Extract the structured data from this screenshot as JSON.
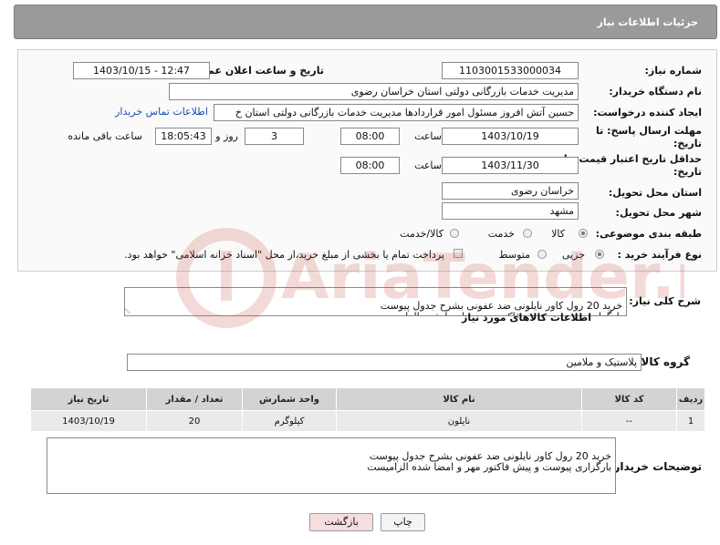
{
  "header": {
    "title": "جزئیات اطلاعات نیاز"
  },
  "form": {
    "need_number_label": "شماره نیاز:",
    "need_number": "1103001533000034",
    "announce_label": "تاریخ و ساعت اعلان عمومی:",
    "announce_value": "1403/10/15 - 12:47",
    "buyer_org_label": "نام دستگاه خریدار:",
    "buyer_org": "مدیریت خدمات بازرگانی دولتی استان خراسان رضوی",
    "creator_label": "ایجاد کننده درخواست:",
    "creator": "حسین آتش افروز مسئول امور قراردادها مدیریت خدمات بازرگانی دولتی استان خ",
    "contact_link": "اطلاعات تماس خریدار",
    "reply_deadline_label_1": "مهلت ارسال پاسخ: تا",
    "reply_deadline_label_2": "تاریخ:",
    "reply_date": "1403/10/19",
    "time_label": "ساعت",
    "reply_time": "08:00",
    "days_value": "3",
    "days_label": "روز و",
    "remaining_time": "18:05:43",
    "remaining_label": "ساعت باقی مانده",
    "price_validity_label_1": "حداقل تاریخ اعتبار قیمت: تا",
    "price_validity_label_2": "تاریخ:",
    "price_date": "1403/11/30",
    "price_time": "08:00",
    "province_label": "استان محل تحویل:",
    "province": "خراسان رضوی",
    "city_label": "شهر محل تحویل:",
    "city": "مشهد",
    "category_label": "طبقه بندی موضوعی:",
    "category_options": [
      "کالا",
      "خدمت",
      "کالا/خدمت"
    ],
    "process_label": "نوع فرآیند خرید :",
    "process_options": [
      "جزیی",
      "متوسط"
    ],
    "payment_note": "پرداخت تمام یا بخشی از مبلغ خرید،از محل \"اسناد خزانه اسلامی\" خواهد بود."
  },
  "description": {
    "label": "شرح کلی نیاز:",
    "text": "خرید 20 رول کاور نایلونی ضد عفونی بشرح جدول پیوست\nبارگزاری پیوست و پیش فاکتور مهر و امضا شده الزامیست"
  },
  "goods_section": {
    "title": "اطلاعات کالاهای مورد نیاز",
    "group_label": "گروه کالا:",
    "group_value": "پلاستیک و ملامین"
  },
  "table": {
    "headers": [
      "ردیف",
      "کد کالا",
      "نام کالا",
      "واحد شمارش",
      "تعداد / مقدار",
      "تاریخ نیاز"
    ],
    "rows": [
      [
        "1",
        "--",
        "نایلون",
        "کیلوگرم",
        "20",
        "1403/10/19"
      ]
    ]
  },
  "buyer_notes": {
    "label": "توضیحات خریدار:",
    "text": "خرید 20 رول کاور نایلونی ضد عفونی بشرح جدول پیوست\nبارگزاری پیوست و پیش فاکتور مهر و امضا شده الزامیست"
  },
  "buttons": {
    "print": "چاپ",
    "back": "بازگشت"
  },
  "watermark": {
    "text": "AriaTender.neT"
  },
  "colors": {
    "header_bg": "#9a9a9a",
    "link": "#1a4fb0",
    "back_button_bg": "#f6dede",
    "watermark": "#c0392b"
  }
}
